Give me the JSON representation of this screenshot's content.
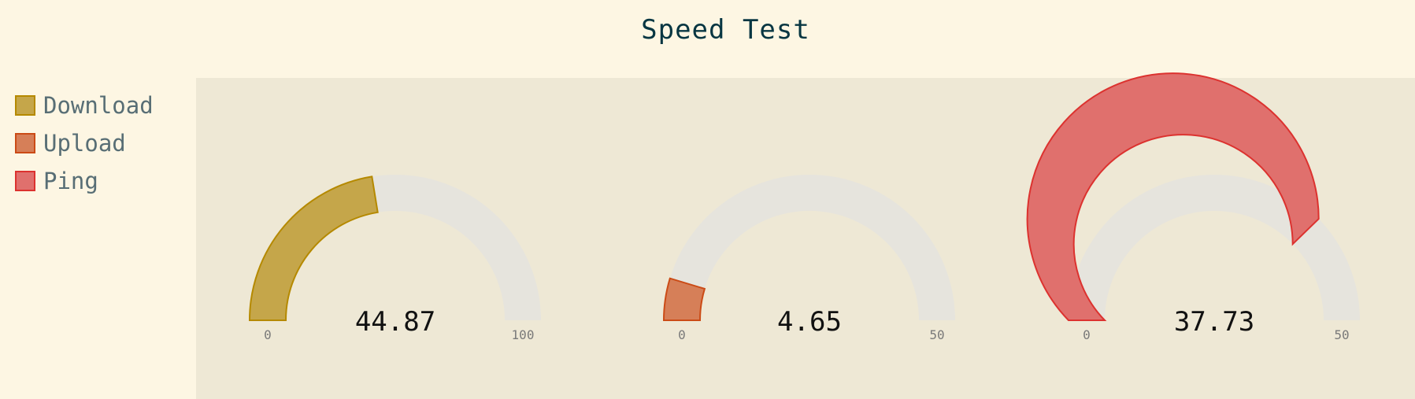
{
  "chart_data": {
    "type": "gauge",
    "title": "Speed Test",
    "legend_position": "left",
    "series": [
      {
        "name": "Download",
        "value": 44.87,
        "value_label": "44.87",
        "min": 0,
        "max": 100,
        "min_label": "0",
        "max_label": "100",
        "fill": "#c5a64a",
        "stroke": "#b58900"
      },
      {
        "name": "Upload",
        "value": 4.65,
        "value_label": "4.65",
        "min": 0,
        "max": 50,
        "min_label": "0",
        "max_label": "50",
        "fill": "#d67f58",
        "stroke": "#cb4b16"
      },
      {
        "name": "Ping",
        "value": 37.73,
        "value_label": "37.73",
        "min": 0,
        "max": 50,
        "min_label": "0",
        "max_label": "50",
        "fill": "#e0706d",
        "stroke": "#dc322f"
      }
    ],
    "track_color": "#e6e4dd"
  }
}
